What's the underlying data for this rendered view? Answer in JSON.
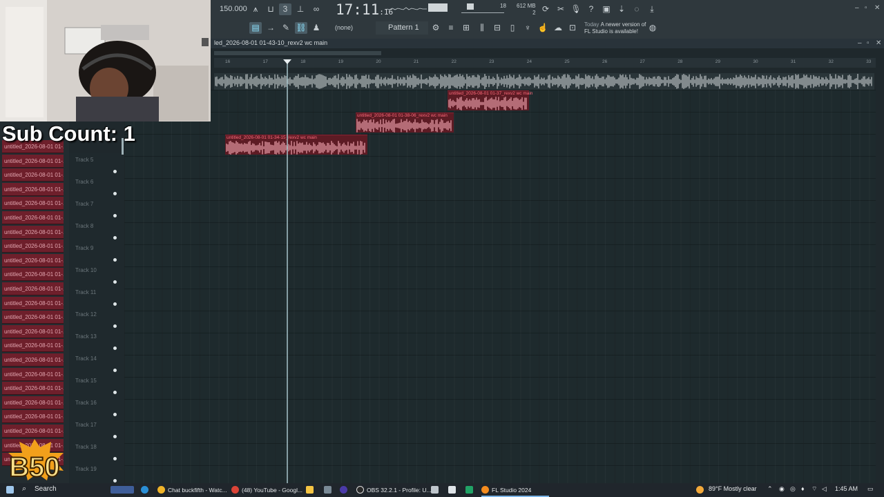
{
  "toolbar": {
    "tempo": "150.000",
    "time": "17:11",
    "time_sub": ":16",
    "cpu_mem": "612 MB",
    "cpu_val": "18",
    "cpu_poly": "2",
    "mixer_input": "(none)",
    "pattern": "Pattern 1",
    "update_title": "Today",
    "update_line1": "A newer version of",
    "update_line2": "FL Studio is available!"
  },
  "playlist": {
    "title": "led_2026-08-01 01-43-10_rexv2 wc main",
    "ruler": [
      "16",
      "17",
      "18",
      "19",
      "20",
      "21",
      "22",
      "23",
      "24",
      "25",
      "26",
      "27",
      "28",
      "29",
      "30",
      "31",
      "32",
      "33"
    ]
  },
  "clips": [
    {
      "label": "untitled_2026-08-01 01-34-15_rexv2 wc main"
    },
    {
      "label": "untitled_2026-08-01 01-38-06_rexv2 wc main"
    },
    {
      "label": "untitled_2026-08-01 01-37_rexv2 wc main"
    }
  ],
  "tracks": [
    "Track 5",
    "Track 6",
    "Track 7",
    "Track 8",
    "Track 9",
    "Track 10",
    "Track 11",
    "Track 12",
    "Track 13",
    "Track 14",
    "Track 15",
    "Track 16",
    "Track 17",
    "Track 18",
    "Track 19"
  ],
  "picker_item": "untitled_2026-08-01 01-...",
  "overlay": {
    "sub_count": "Sub Count: 1",
    "badge": "B50"
  },
  "taskbar": {
    "search": "Search",
    "apps": [
      "Chat buckfifth - Watc...",
      "(48) YouTube - Googl...",
      "OBS 32.2.1 - Profile: U...",
      "FL Studio 2024"
    ],
    "weather": "89°F  Mostly clear",
    "clock": "1:45 AM"
  },
  "colors": {
    "clip": "#5d1b24",
    "clip_label": "#ff6b7c",
    "background": "#1e2a2d"
  }
}
